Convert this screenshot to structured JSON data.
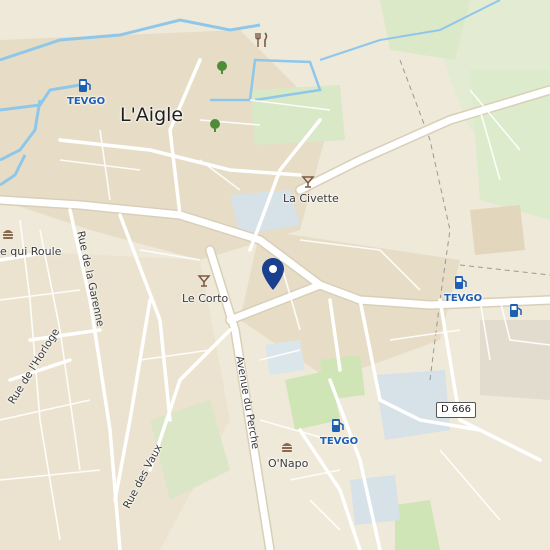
{
  "map": {
    "town": "L'Aigle",
    "pois": {
      "la_civette": "La Civette",
      "le_corto": "Le Corto",
      "onapo": "O'Napo",
      "qui_roule": "e qui Roule",
      "tevgo_1": "TEVGO",
      "tevgo_2": "TEVGO",
      "tevgo_3": "TEVGO"
    },
    "streets": {
      "garenne": "Rue de la Garenne",
      "horloge": "Rue de l'Horloge",
      "perche": "Avenue du Perche",
      "vaux": "Rue des Vaux"
    },
    "road_shield": "D 666",
    "icons": {
      "pin": "location-pin-icon",
      "fuel": "ev-charging-icon",
      "bar": "cocktail-bar-icon",
      "burger": "fast-food-icon",
      "restaurant": "restaurant-icon",
      "tree": "tree-icon"
    },
    "colors": {
      "land": "#efe9d9",
      "built": "#e6dcc5",
      "park": "#d6e8c4",
      "water": "#8ec7ea",
      "road": "#ffffff",
      "pin": "#1a3f8f",
      "ev_blue": "#1f5fb3"
    }
  }
}
